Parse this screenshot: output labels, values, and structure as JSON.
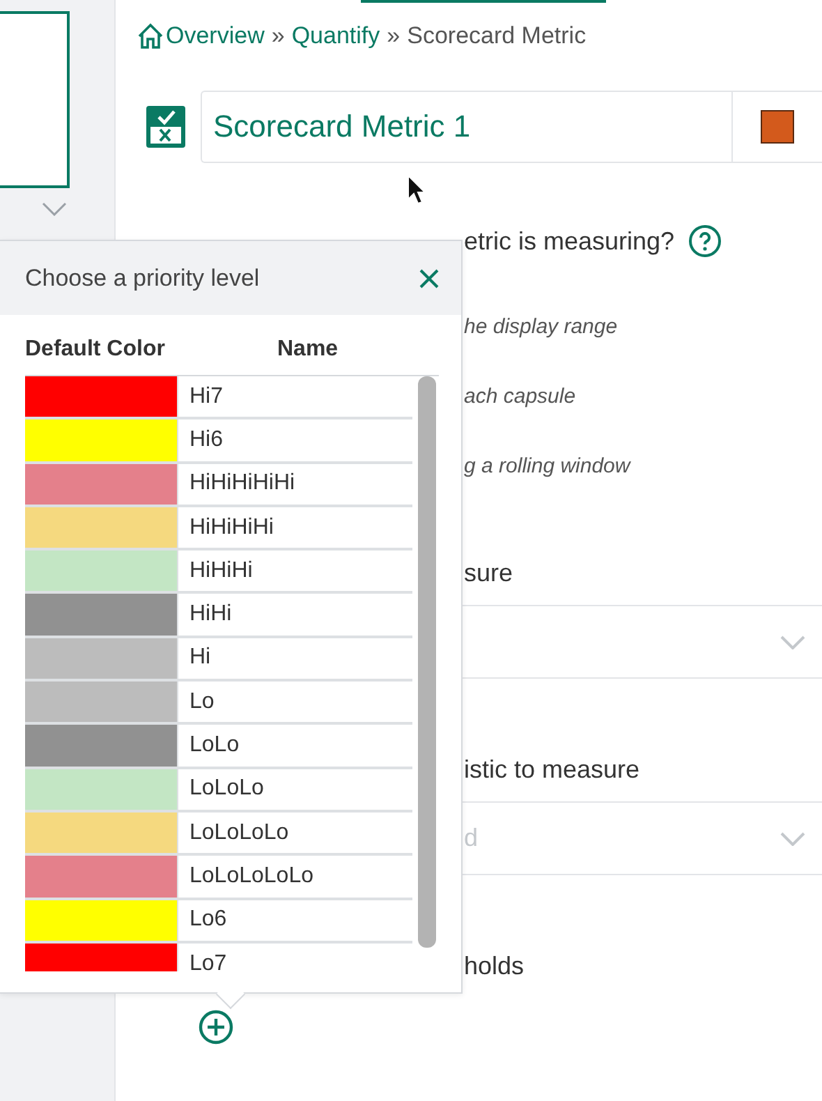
{
  "breadcrumb": [
    {
      "kind": "home",
      "text": "Overview"
    },
    {
      "kind": "sep",
      "text": "»"
    },
    {
      "kind": "link",
      "text": "Quantify"
    },
    {
      "kind": "sep",
      "text": "»"
    },
    {
      "kind": "current",
      "text": "Scorecard Metric"
    }
  ],
  "metric": {
    "name": "Scorecard Metric 1",
    "color": "#d35a1c"
  },
  "form": [
    {
      "kind": "question",
      "text": "etric is measuring?"
    },
    {
      "kind": "hint",
      "text": "he display range"
    },
    {
      "kind": "hint",
      "text": "ach capsule"
    },
    {
      "kind": "hint",
      "text": "g a rolling window"
    },
    {
      "kind": "label",
      "text": "sure"
    },
    {
      "kind": "dropdown"
    },
    {
      "kind": "label",
      "text": "istic to measure"
    },
    {
      "kind": "dropdown",
      "placeholder": "d"
    },
    {
      "kind": "label",
      "text": "holds"
    }
  ],
  "popover": {
    "title": "Choose a priority level",
    "columns": [
      "Default Color",
      "Name"
    ],
    "rows": [
      {
        "name": "Hi7",
        "color": "#ff0000"
      },
      {
        "name": "Hi6",
        "color": "#ffff00"
      },
      {
        "name": "HiHiHiHiHi",
        "color": "#e4808b"
      },
      {
        "name": "HiHiHiHi",
        "color": "#f5d97f"
      },
      {
        "name": "HiHiHi",
        "color": "#c3e6c4"
      },
      {
        "name": "HiHi",
        "color": "#919191"
      },
      {
        "name": "Hi",
        "color": "#bcbcbc"
      },
      {
        "name": "Lo",
        "color": "#bcbcbc"
      },
      {
        "name": "LoLo",
        "color": "#919191"
      },
      {
        "name": "LoLoLo",
        "color": "#c3e6c4"
      },
      {
        "name": "LoLoLoLo",
        "color": "#f5d97f"
      },
      {
        "name": "LoLoLoLoLo",
        "color": "#e4808b"
      },
      {
        "name": "Lo6",
        "color": "#ffff00"
      },
      {
        "name": "Lo7",
        "color": "#ff0000"
      }
    ]
  }
}
